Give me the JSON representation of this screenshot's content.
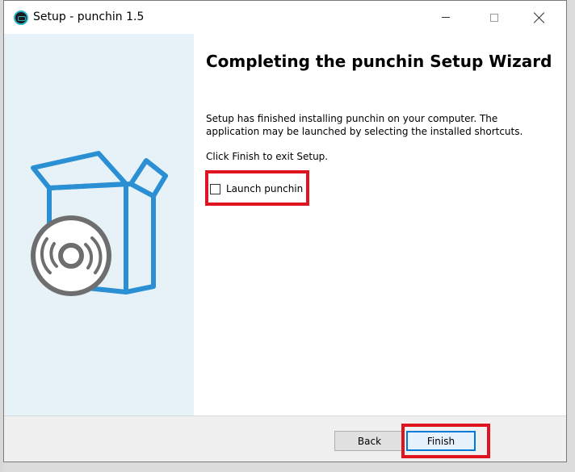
{
  "window": {
    "title": "Setup - punchin 1.5",
    "icon": "punchin-app-icon",
    "controls": {
      "minimize_icon": "minimize-icon",
      "maximize_icon": "maximize-icon",
      "close_icon": "close-icon"
    }
  },
  "side_panel": {
    "image": "software-box-cd-illustration"
  },
  "content": {
    "heading": "Completing the punchin Setup Wizard",
    "description": "Setup has finished installing punchin on your computer. The application may be launched by selecting the installed shortcuts.",
    "hint": "Click Finish to exit Setup.",
    "launch_checkbox": {
      "label": "Launch punchin",
      "checked": false
    }
  },
  "buttons": {
    "back_label": "Back",
    "finish_label": "Finish"
  },
  "colors": {
    "highlight": "#e0141e",
    "side_panel_bg": "#e6f1f8",
    "box_blue": "#2a8fd3",
    "disc_gray": "#6e6e6e",
    "focus_blue": "#0078d7"
  }
}
